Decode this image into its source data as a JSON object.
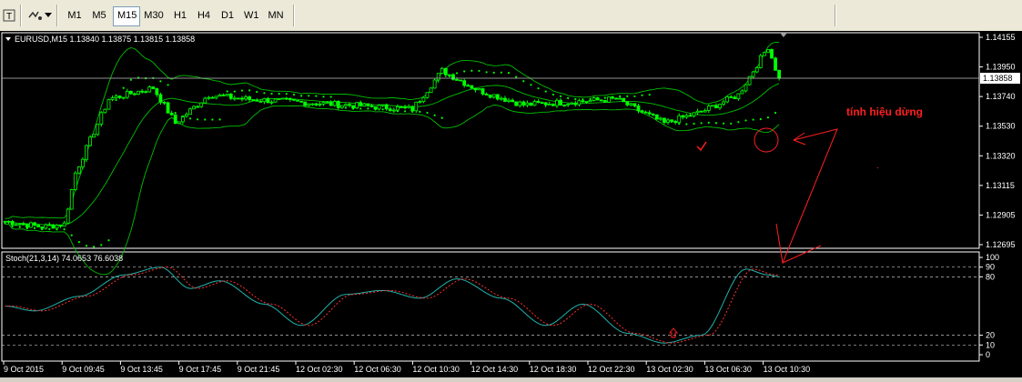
{
  "toolbar": {
    "timeframes": [
      {
        "label": "M1",
        "active": false
      },
      {
        "label": "M5",
        "active": false
      },
      {
        "label": "M15",
        "active": true
      },
      {
        "label": "M30",
        "active": false
      },
      {
        "label": "H1",
        "active": false
      },
      {
        "label": "H4",
        "active": false
      },
      {
        "label": "D1",
        "active": false
      },
      {
        "label": "W1",
        "active": false
      },
      {
        "label": "MN",
        "active": false
      }
    ],
    "icons": [
      "text-tool-icon",
      "objects-icon",
      "dropdown-arrow-icon"
    ]
  },
  "chart": {
    "header": "EURUSD,M15  1.13840 1.13875 1.13815 1.13858",
    "current_price": "1.13858",
    "price_ticks": [
      "1.14155",
      "1.13950",
      "1.13740",
      "1.13530",
      "1.13320",
      "1.13115",
      "1.12905",
      "1.12695"
    ],
    "indicator_header": "Stoch(21,3,14) 74.0653 76.6038",
    "indicator_ticks": [
      "100",
      "90",
      "80",
      "20",
      "10",
      "0"
    ],
    "time_labels": [
      "9 Oct 2015",
      "9 Oct 09:45",
      "9 Oct 13:45",
      "9 Oct 17:45",
      "9 Oct 21:45",
      "12 Oct 02:30",
      "12 Oct 06:30",
      "12 Oct 10:30",
      "12 Oct 14:30",
      "12 Oct 18:30",
      "12 Oct 22:30",
      "13 Oct 02:30",
      "13 Oct 06:30",
      "13 Oct 10:30"
    ],
    "annotation": "tính hiệu dừng",
    "colors": {
      "background": "#000000",
      "candles": "#00ff00",
      "bands": "#00c000",
      "sar": "#00ff00",
      "stoch_main": "#20b2aa",
      "stoch_signal": "#ff3030",
      "annotation": "#ff2020"
    }
  }
}
